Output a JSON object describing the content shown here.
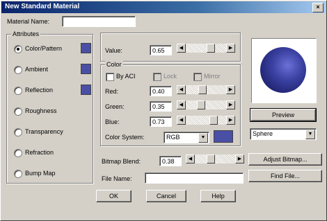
{
  "window": {
    "title": "New Standard Material",
    "close_label": "×"
  },
  "material_name": {
    "label": "Material Name:",
    "value": ""
  },
  "attributes": {
    "title": "Attributes",
    "items": [
      {
        "label": "Color/Pattern",
        "selected": true,
        "has_swatch": true
      },
      {
        "label": "Ambient",
        "selected": false,
        "has_swatch": true
      },
      {
        "label": "Reflection",
        "selected": false,
        "has_swatch": true
      },
      {
        "label": "Roughness",
        "selected": false,
        "has_swatch": false
      },
      {
        "label": "Transparency",
        "selected": false,
        "has_swatch": false
      },
      {
        "label": "Refraction",
        "selected": false,
        "has_swatch": false
      },
      {
        "label": "Bump Map",
        "selected": false,
        "has_swatch": false
      }
    ]
  },
  "value": {
    "label": "Value:",
    "value": "0.65",
    "level": 0.65
  },
  "color": {
    "title": "Color",
    "by_aci": "By ACI",
    "lock": "Lock",
    "mirror": "Mirror",
    "red": {
      "label": "Red:",
      "value": "0.40",
      "level": 0.4
    },
    "green": {
      "label": "Green:",
      "value": "0.35",
      "level": 0.35
    },
    "blue": {
      "label": "Blue:",
      "value": "0.73",
      "level": 0.73
    },
    "system_label": "Color System:",
    "system_value": "RGB",
    "swatch_color": "#4a4fa6"
  },
  "preview": {
    "button": "Preview",
    "shape": "Sphere"
  },
  "bitmap": {
    "label": "Bitmap Blend:",
    "value": "0.38",
    "level": 0.38
  },
  "adjust_bitmap": "Adjust Bitmap...",
  "file_name": {
    "label": "File Name:",
    "value": ""
  },
  "find_file": "Find File...",
  "buttons": {
    "ok": "OK",
    "cancel": "Cancel",
    "help": "Help"
  }
}
